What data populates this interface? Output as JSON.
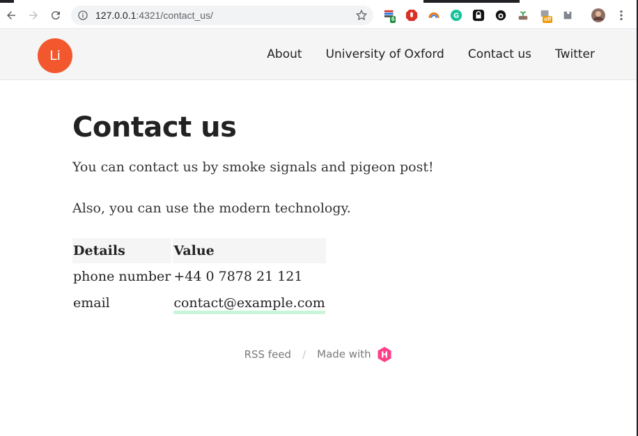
{
  "browser": {
    "url_host": "127.0.0.1",
    "url_rest": ":4321/contact_us/",
    "extensions": [
      "stack-ext-icon",
      "adblock-icon",
      "rainbow-icon",
      "grammarly-icon",
      "lock-ext-icon",
      "github-icon",
      "plant-icon",
      "off-badge-icon",
      "puzzle-icon"
    ],
    "ext_badge_count": "6",
    "ext_badge_off": "off"
  },
  "site": {
    "logo_text": "Li",
    "nav": [
      "About",
      "University of Oxford",
      "Contact us",
      "Twitter"
    ],
    "accent": "#f2572d"
  },
  "page": {
    "title": "Contact us",
    "para1": "You can contact us by smoke signals and pigeon post!",
    "para2": "Also, you can use the modern technology."
  },
  "table": {
    "headers": [
      "Details",
      "Value"
    ],
    "rows": [
      [
        "phone number",
        "+44 0 7878 21 121"
      ],
      [
        "email",
        "contact@example.com"
      ]
    ]
  },
  "footer": {
    "rss": "RSS feed",
    "sep": "/",
    "made_with": "Made with",
    "hugo_letter": "H"
  }
}
